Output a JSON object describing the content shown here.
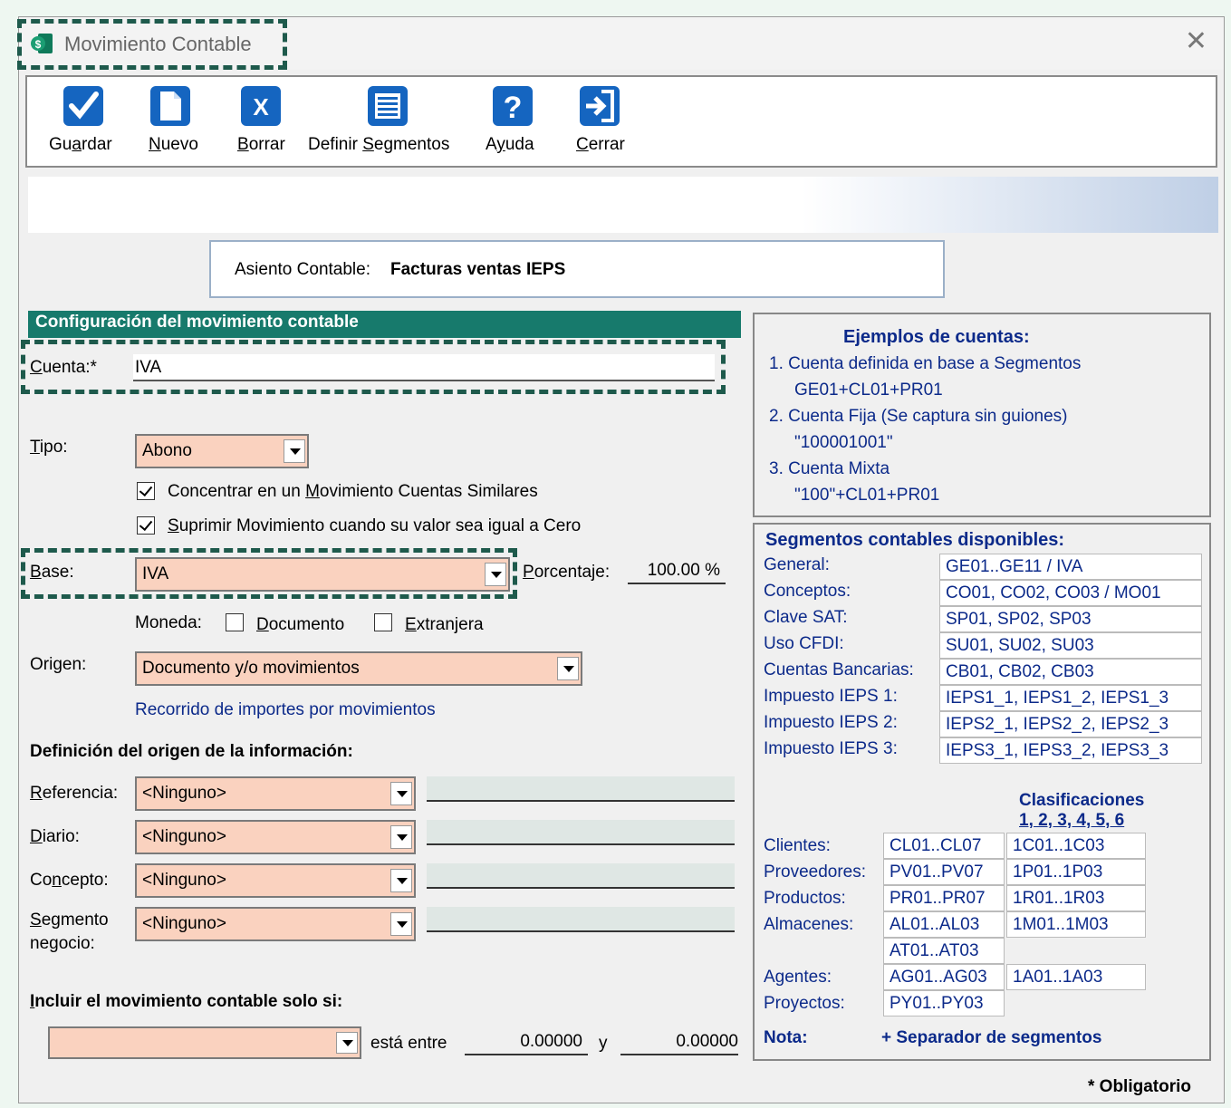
{
  "window": {
    "title": "Movimiento Contable",
    "close_glyph": "✕"
  },
  "toolbar": {
    "guardar": {
      "pre": "Gu",
      "key": "a",
      "post": "rdar"
    },
    "nuevo": {
      "pre": "",
      "key": "N",
      "post": "uevo"
    },
    "borrar": {
      "pre": "",
      "key": "B",
      "post": "orrar"
    },
    "definir": {
      "pre": "Definir ",
      "key": "S",
      "post": "egmentos"
    },
    "ayuda": {
      "pre": "A",
      "key": "y",
      "post": "uda"
    },
    "cerrar": {
      "pre": "",
      "key": "C",
      "post": "errar"
    }
  },
  "asiento": {
    "label": "Asiento Contable:",
    "value": "Facturas ventas IEPS"
  },
  "section_title": "Configuración del movimiento contable",
  "cuenta": {
    "key": "C",
    "post": "uenta:*",
    "value": "IVA"
  },
  "tipo": {
    "key": "T",
    "post": "ipo:",
    "value": "Abono"
  },
  "check_concentrar": {
    "pre": "Concentrar en un ",
    "key": "M",
    "post": "ovimiento Cuentas Similares",
    "checked": true
  },
  "check_suprimir": {
    "pre": "",
    "key": "S",
    "post": "uprimir Movimiento cuando su valor sea igual a Cero",
    "checked": true
  },
  "base": {
    "key": "B",
    "post": "ase:",
    "value": "IVA"
  },
  "porcentaje": {
    "key": "P",
    "post": "orcentaje:",
    "value": "100.00 %"
  },
  "moneda": {
    "label": "Moneda:",
    "documento": {
      "pre": "",
      "key": "D",
      "post": "ocumento",
      "checked": false
    },
    "extranjera": {
      "pre": "",
      "key": "E",
      "post": "xtranjera",
      "checked": false
    }
  },
  "origen": {
    "pre": "Ori",
    "key": "g",
    "post": "en:",
    "value": "Documento y/o movimientos",
    "link": "Recorrido de importes por movimientos"
  },
  "definicion_title": "Definición del origen de la información:",
  "referencia": {
    "key": "R",
    "post": "eferencia:",
    "value": "<Ninguno>"
  },
  "diario": {
    "key": "D",
    "post": "iario:",
    "value": "<Ninguno>"
  },
  "concepto": {
    "pre": "Co",
    "key": "n",
    "post": "cepto:",
    "value": "<Ninguno>"
  },
  "segmento": {
    "key": "S",
    "post": "egmento",
    "line2": "negocio:",
    "value": "<Ninguno>"
  },
  "incluir": {
    "key": "I",
    "post": "ncluir el movimiento contable solo si:",
    "combo_value": "",
    "entre": "está entre",
    "from": "0.00000",
    "y": "y",
    "to": "0.00000"
  },
  "ejemplos": {
    "title": "Ejemplos de cuentas:",
    "lines": [
      "1. Cuenta definida en base a Segmentos",
      "GE01+CL01+PR01",
      "2. Cuenta Fija  (Se captura sin guiones)",
      "\"100001001\"",
      "3. Cuenta Mixta",
      "\"100\"+CL01+PR01"
    ]
  },
  "segmentos": {
    "title": "Segmentos contables disponibles:",
    "rows": [
      {
        "label": "General:",
        "value": "GE01..GE11 / IVA"
      },
      {
        "label": "Conceptos:",
        "value": "CO01, CO02, CO03 / MO01"
      },
      {
        "label": "Clave SAT:",
        "value": "SP01, SP02, SP03"
      },
      {
        "label": "Uso CFDI:",
        "value": "SU01, SU02, SU03"
      },
      {
        "label": "Cuentas Bancarias:",
        "value": "CB01, CB02, CB03"
      },
      {
        "label": "Impuesto IEPS 1:",
        "value": "IEPS1_1, IEPS1_2, IEPS1_3"
      },
      {
        "label": "Impuesto IEPS 2:",
        "value": "IEPS2_1, IEPS2_2, IEPS2_3"
      },
      {
        "label": "Impuesto IEPS 3:",
        "value": "IEPS3_1, IEPS3_2, IEPS3_3"
      }
    ],
    "clasif_title1": "Clasificaciones",
    "clasif_title2": "1, 2, 3, 4, 5, 6",
    "clasif_rows": [
      {
        "label": "Clientes:",
        "seg": "CL01..CL07",
        "clas": "1C01..1C03"
      },
      {
        "label": "Proveedores:",
        "seg": "PV01..PV07",
        "clas": "1P01..1P03"
      },
      {
        "label": "Productos:",
        "seg": "PR01..PR07",
        "clas": "1R01..1R03"
      },
      {
        "label": "Almacenes:",
        "seg": "AL01..AL03",
        "clas": "1M01..1M03"
      },
      {
        "label": "",
        "seg": "AT01..AT03",
        "clas": ""
      },
      {
        "label": "Agentes:",
        "seg": "AG01..AG03",
        "clas": "1A01..1A03"
      },
      {
        "label": "Proyectos:",
        "seg": "PY01..PY03",
        "clas": ""
      }
    ],
    "nota_label": "Nota:",
    "nota_text": "+ Separador de segmentos"
  },
  "obligatorio": "* Obligatorio",
  "colors": {
    "section_bar": "#177a6c",
    "combo_fill": "#fad2bf",
    "icon_blue": "#1565c0",
    "dash": "#1e5a4c",
    "navy": "#0c2a8a"
  }
}
